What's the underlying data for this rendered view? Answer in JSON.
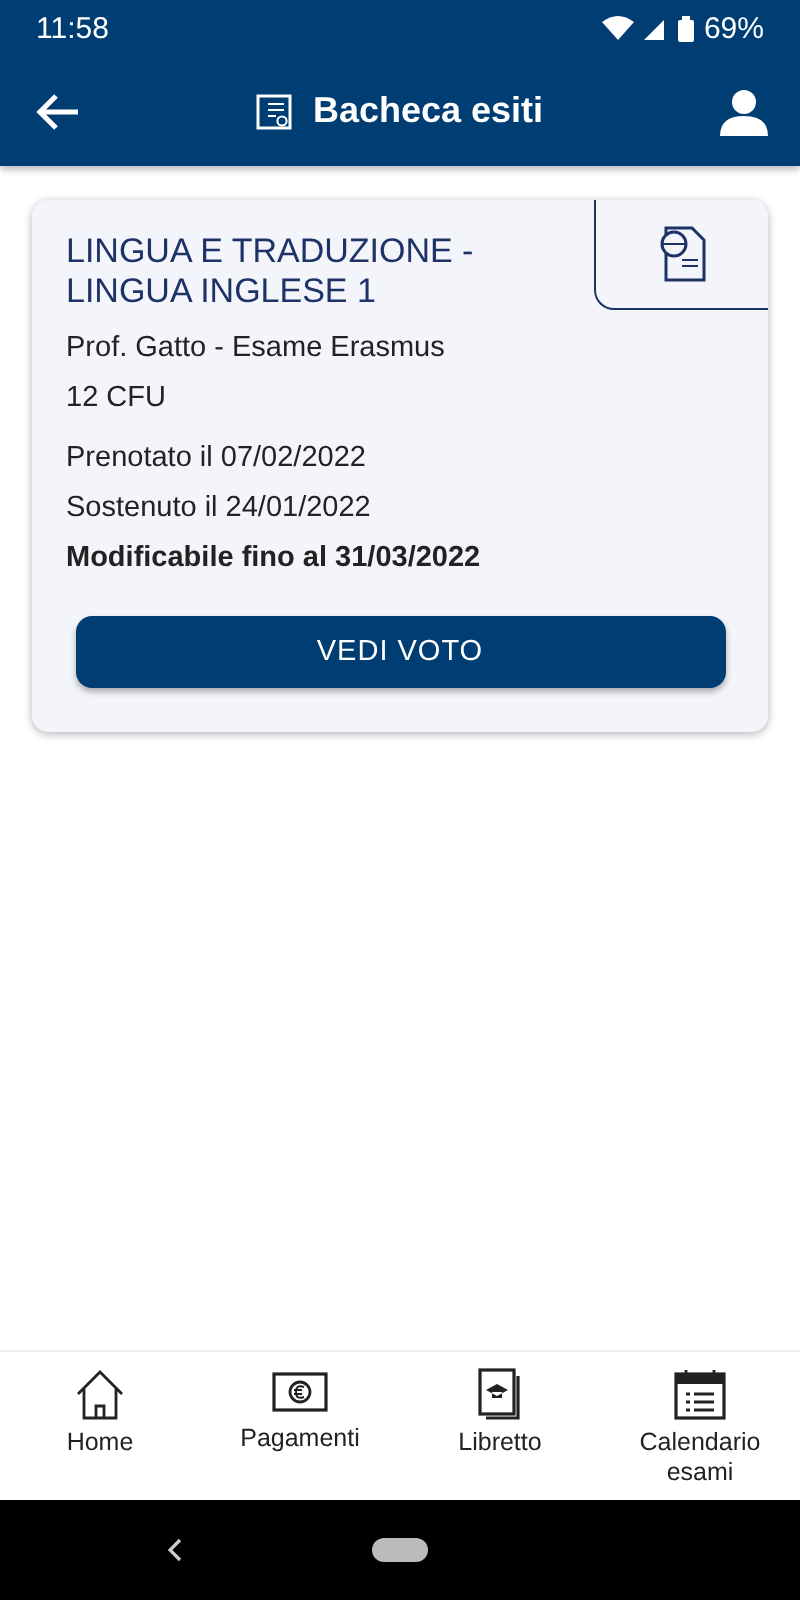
{
  "status_bar": {
    "time": "11:58",
    "battery": "69%"
  },
  "app_bar": {
    "title": "Bacheca esiti"
  },
  "cards": [
    {
      "title": "LINGUA E TRADUZIONE - LINGUA INGLESE 1",
      "teacher": "Prof. Gatto - Esame Erasmus",
      "credits": "12 CFU",
      "booked": "Prenotato il 07/02/2022",
      "taken": "Sostenuto il 24/01/2022",
      "deadline": "Modificabile fino al 31/03/2022",
      "button": "VEDI VOTO"
    }
  ],
  "bottom_nav": [
    {
      "label": "Home",
      "kind": "home"
    },
    {
      "label": "Pagamenti",
      "kind": "payments"
    },
    {
      "label": "Libretto",
      "kind": "booklet"
    },
    {
      "label": "Calendario esami",
      "kind": "calendar"
    }
  ]
}
